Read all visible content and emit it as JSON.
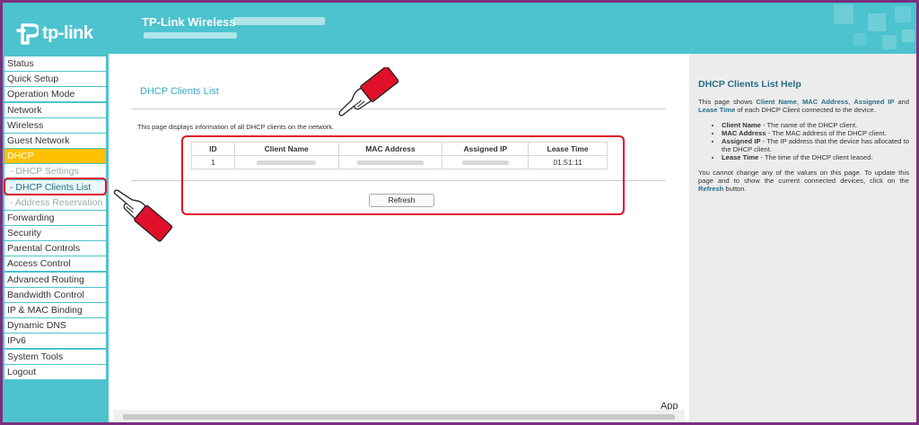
{
  "header": {
    "brand": "tp-link",
    "title": "TP-Link Wireless"
  },
  "sidebar": {
    "items": [
      {
        "label": "Status",
        "type": "item"
      },
      {
        "label": "Quick Setup",
        "type": "item"
      },
      {
        "label": "Operation Mode",
        "type": "item"
      },
      {
        "label": "Network",
        "type": "item"
      },
      {
        "label": "Wireless",
        "type": "item"
      },
      {
        "label": "Guest Network",
        "type": "item"
      },
      {
        "label": "DHCP",
        "type": "active"
      },
      {
        "label": "- DHCP Settings",
        "type": "sub"
      },
      {
        "label": "- DHCP Clients List",
        "type": "current"
      },
      {
        "label": "- Address Reservation",
        "type": "sub"
      },
      {
        "label": "Forwarding",
        "type": "item"
      },
      {
        "label": "Security",
        "type": "item"
      },
      {
        "label": "Parental Controls",
        "type": "item"
      },
      {
        "label": "Access Control",
        "type": "item"
      },
      {
        "label": "Advanced Routing",
        "type": "item"
      },
      {
        "label": "Bandwidth Control",
        "type": "item"
      },
      {
        "label": "IP & MAC Binding",
        "type": "item"
      },
      {
        "label": "Dynamic DNS",
        "type": "item"
      },
      {
        "label": "IPv6",
        "type": "item"
      },
      {
        "label": "System Tools",
        "type": "item"
      },
      {
        "label": "Logout",
        "type": "item"
      }
    ]
  },
  "main": {
    "title": "DHCP Clients List",
    "description": "This page displays information of all DHCP clients on the network.",
    "table": {
      "headers": [
        "ID",
        "Client Name",
        "MAC Address",
        "Assigned IP",
        "Lease Time"
      ],
      "rows": [
        {
          "id": "1",
          "lease": "01:51:11"
        }
      ]
    },
    "refresh_label": "Refresh",
    "app_link": "App"
  },
  "help": {
    "title": "DHCP Clients List Help",
    "intro_1": "This page shows ",
    "intro_b1": "Client Name",
    "intro_2": ", ",
    "intro_b2": "MAC Address",
    "intro_3": ", ",
    "intro_b3": "Assigned IP",
    "intro_4": " and ",
    "intro_b4": "Lease Time",
    "intro_5": " of each DHCP Client connected to the device.",
    "bullets": [
      {
        "term": "Client Name",
        "text": " - The name of the DHCP client."
      },
      {
        "term": "MAC Address",
        "text": " - The MAC address of the DHCP client."
      },
      {
        "term": "Assigned IP",
        "text": " - The IP address that the device has allocated to the DHCP client."
      },
      {
        "term": "Lease Time",
        "text": " - The time of the DHCP client leased."
      }
    ],
    "outro_1": "You cannot change any of the values on this page. To update this page and to show the current connected devices, click on the ",
    "outro_b": "Refresh",
    "outro_2": " button."
  },
  "colors": {
    "brand_teal": "#4cc3cf",
    "active_menu": "#ffc000",
    "highlight_red": "#e0102a",
    "frame_purple": "#7b2f7e"
  }
}
